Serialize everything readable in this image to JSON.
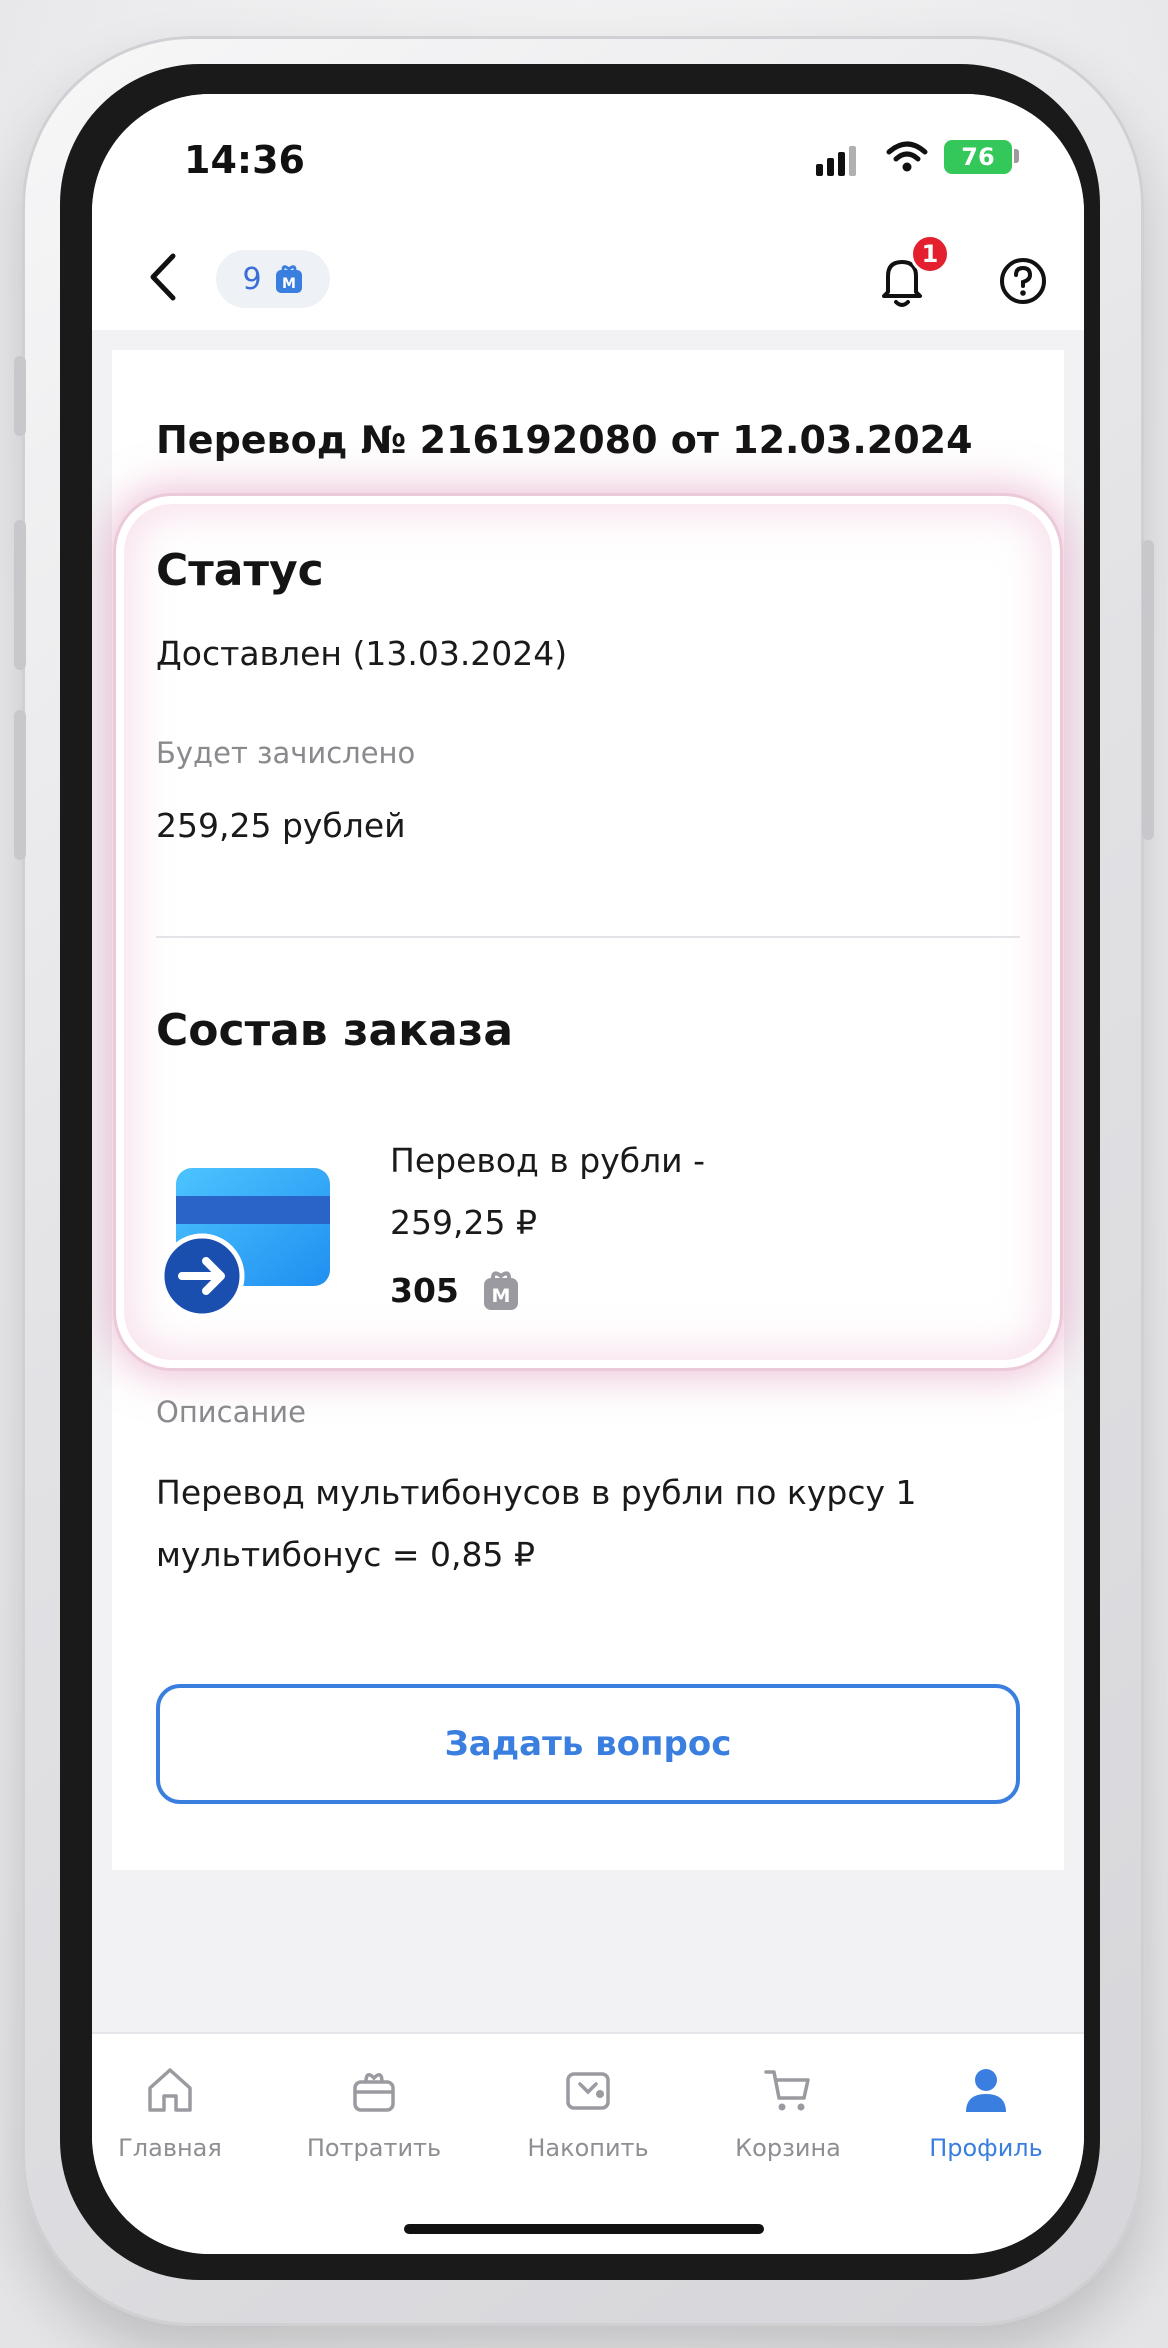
{
  "status_bar": {
    "time": "14:36",
    "battery": "76"
  },
  "header": {
    "points": "9",
    "notification_count": "1",
    "icons": [
      "back-arrow-icon",
      "multibonus-icon",
      "bell-icon",
      "help-icon"
    ]
  },
  "transfer": {
    "title": "Перевод № 216192080 от 12.03.2024",
    "status_heading": "Статус",
    "status_value": "Доставлен (13.03.2024)",
    "credit_label": "Будет зачислено",
    "credit_value": "259,25 рублей"
  },
  "order": {
    "heading": "Состав заказа",
    "item_name": "Перевод в рубли - 259,25 ₽",
    "item_points": "305"
  },
  "description": {
    "label": "Описание",
    "text": "Перевод мультибонусов в рубли по курсу 1 мультибонус = 0,85 ₽"
  },
  "ask_button": "Задать вопрос",
  "tabs": [
    {
      "label": "Главная",
      "icon": "home-icon",
      "active": false
    },
    {
      "label": "Потратить",
      "icon": "gift-icon",
      "active": false
    },
    {
      "label": "Накопить",
      "icon": "wallet-icon",
      "active": false
    },
    {
      "label": "Корзина",
      "icon": "cart-icon",
      "active": false
    },
    {
      "label": "Профиль",
      "icon": "profile-icon",
      "active": true
    }
  ],
  "colors": {
    "accent": "#3a7fe0",
    "badge": "#e5202e",
    "battery": "#34c759"
  }
}
